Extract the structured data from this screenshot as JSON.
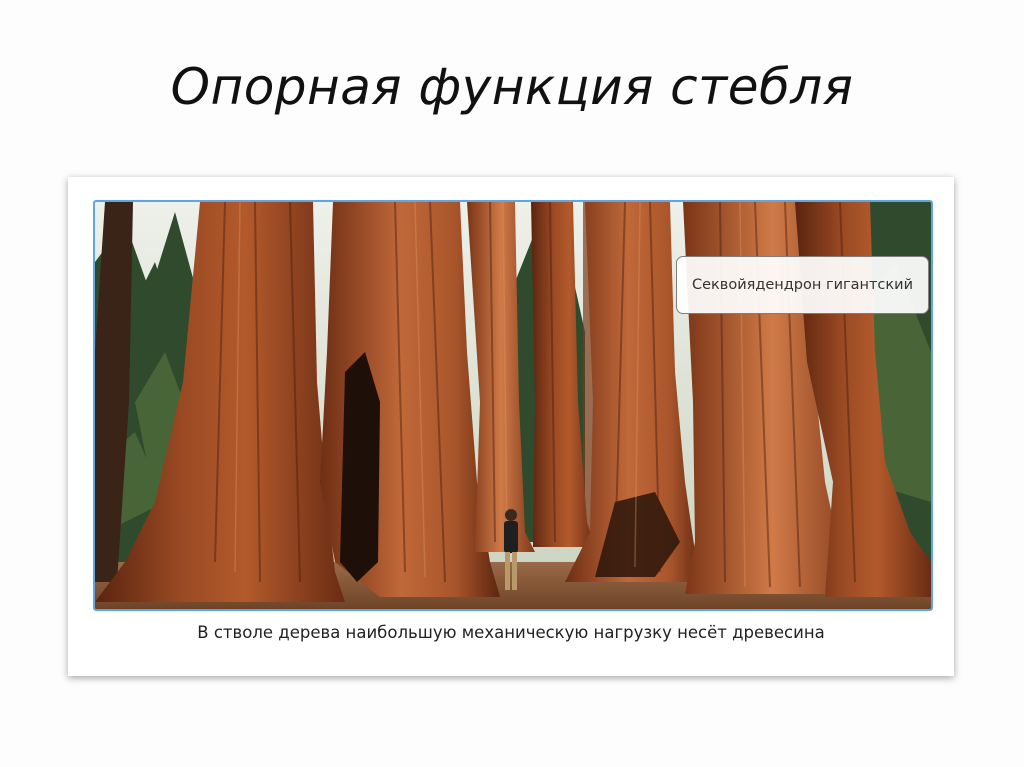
{
  "slide": {
    "title": "Опорная функция стебля",
    "label": "Секвойядендрон гигантский",
    "caption": "В стволе дерева наибольшую механическую нагрузку несёт древесина"
  },
  "colors": {
    "frame_border": "#5ea6e4",
    "trunk_bark": "#8b3e1f",
    "forest_green": "#2f4a2c",
    "ground": "#8a5a3a"
  }
}
